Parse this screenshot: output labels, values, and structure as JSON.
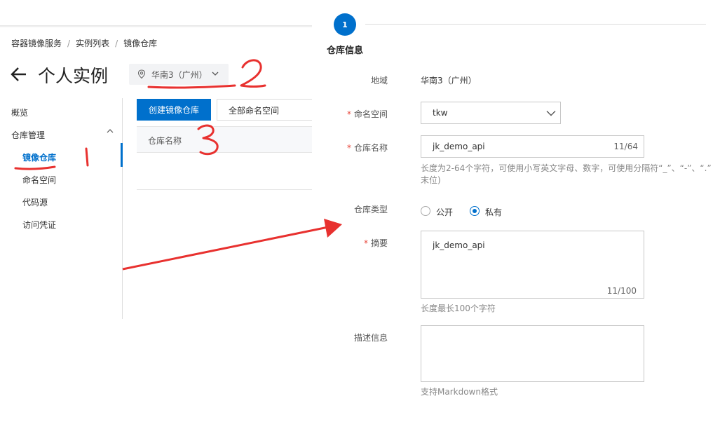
{
  "breadcrumb": {
    "items": [
      "容器镜像服务",
      "实例列表",
      "镜像仓库"
    ]
  },
  "header": {
    "title": "个人实例",
    "region": "华南3（广州）"
  },
  "sidebar": {
    "items": [
      {
        "label": "概览"
      },
      {
        "label": "仓库管理"
      },
      {
        "label": "镜像仓库"
      },
      {
        "label": "命名空间"
      },
      {
        "label": "代码源"
      },
      {
        "label": "访问凭证"
      }
    ]
  },
  "toolbar": {
    "create_label": "创建镜像仓库",
    "namespace_filter": "全部命名空间"
  },
  "table": {
    "columns": [
      "仓库名称"
    ]
  },
  "annotations": [
    "1",
    "2",
    "3"
  ],
  "form": {
    "step_number": "1",
    "step_title": "仓库信息",
    "region_label": "地域",
    "region_value": "华南3（广州）",
    "namespace_label": "命名空间",
    "namespace_value": "tkw",
    "repo_name_label": "仓库名称",
    "repo_name_value": "jk_demo_api",
    "repo_name_count": "11/64",
    "repo_name_hint": "长度为2-64个字符，可使用小写英文字母、数字，可使用分隔符“_”、“-”、“.”",
    "repo_name_hint2": "末位)",
    "repo_type_label": "仓库类型",
    "repo_type_options": [
      "公开",
      "私有"
    ],
    "repo_type_selected": "私有",
    "summary_label": "摘要",
    "summary_value": "jk_demo_api",
    "summary_count": "11/100",
    "summary_hint": "长度最长100个字符",
    "description_label": "描述信息",
    "description_hint": "支持Markdown格式"
  },
  "colors": {
    "primary": "#0070cc",
    "required": "#e8463a",
    "annotation": "#e8312f"
  }
}
